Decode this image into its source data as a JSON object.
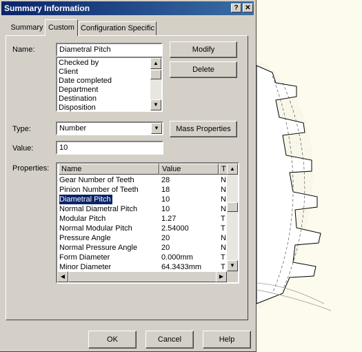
{
  "window": {
    "title": "Summary Information",
    "help_glyph": "?",
    "close_glyph": "✕"
  },
  "tabs": [
    {
      "label": "Summary",
      "active": false
    },
    {
      "label": "Custom",
      "active": true
    },
    {
      "label": "Configuration Specific",
      "active": false
    }
  ],
  "name": {
    "label": "Name:",
    "value": "Diametral Pitch"
  },
  "name_list": [
    "Checked by",
    "Client",
    "Date completed",
    "Department",
    "Destination",
    "Disposition"
  ],
  "type": {
    "label": "Type:",
    "value": "Number"
  },
  "value": {
    "label": "Value:",
    "value": "10"
  },
  "buttons": {
    "modify": "Modify",
    "delete": "Delete",
    "mass_properties": "Mass Properties",
    "ok": "OK",
    "cancel": "Cancel",
    "help": "Help"
  },
  "properties": {
    "label": "Properties:",
    "columns": [
      "Name",
      "Value",
      "T"
    ],
    "rows": [
      {
        "name": "Gear Number of Teeth",
        "value": "28",
        "type": "N"
      },
      {
        "name": "Pinion Number of Teeth",
        "value": "18",
        "type": "N"
      },
      {
        "name": "Diametral Pitch",
        "value": "10",
        "type": "N",
        "selected": true
      },
      {
        "name": "Normal Diametral Pitch",
        "value": "10",
        "type": "N"
      },
      {
        "name": "Modular Pitch",
        "value": "1.27",
        "type": "T"
      },
      {
        "name": "Normal Modular Pitch",
        "value": "2.54000",
        "type": "T"
      },
      {
        "name": "Pressure Angle",
        "value": "20",
        "type": "N"
      },
      {
        "name": "Normal Pressure Angle",
        "value": "20",
        "type": "N"
      },
      {
        "name": "Form Diameter",
        "value": "0.000mm",
        "type": "T"
      },
      {
        "name": "Minor Diameter",
        "value": "64.3433mm",
        "type": "T"
      }
    ]
  },
  "icons": {
    "scroll_up": "▲",
    "scroll_down": "▼",
    "scroll_left": "◀",
    "scroll_right": "▶",
    "dropdown": "▼"
  }
}
